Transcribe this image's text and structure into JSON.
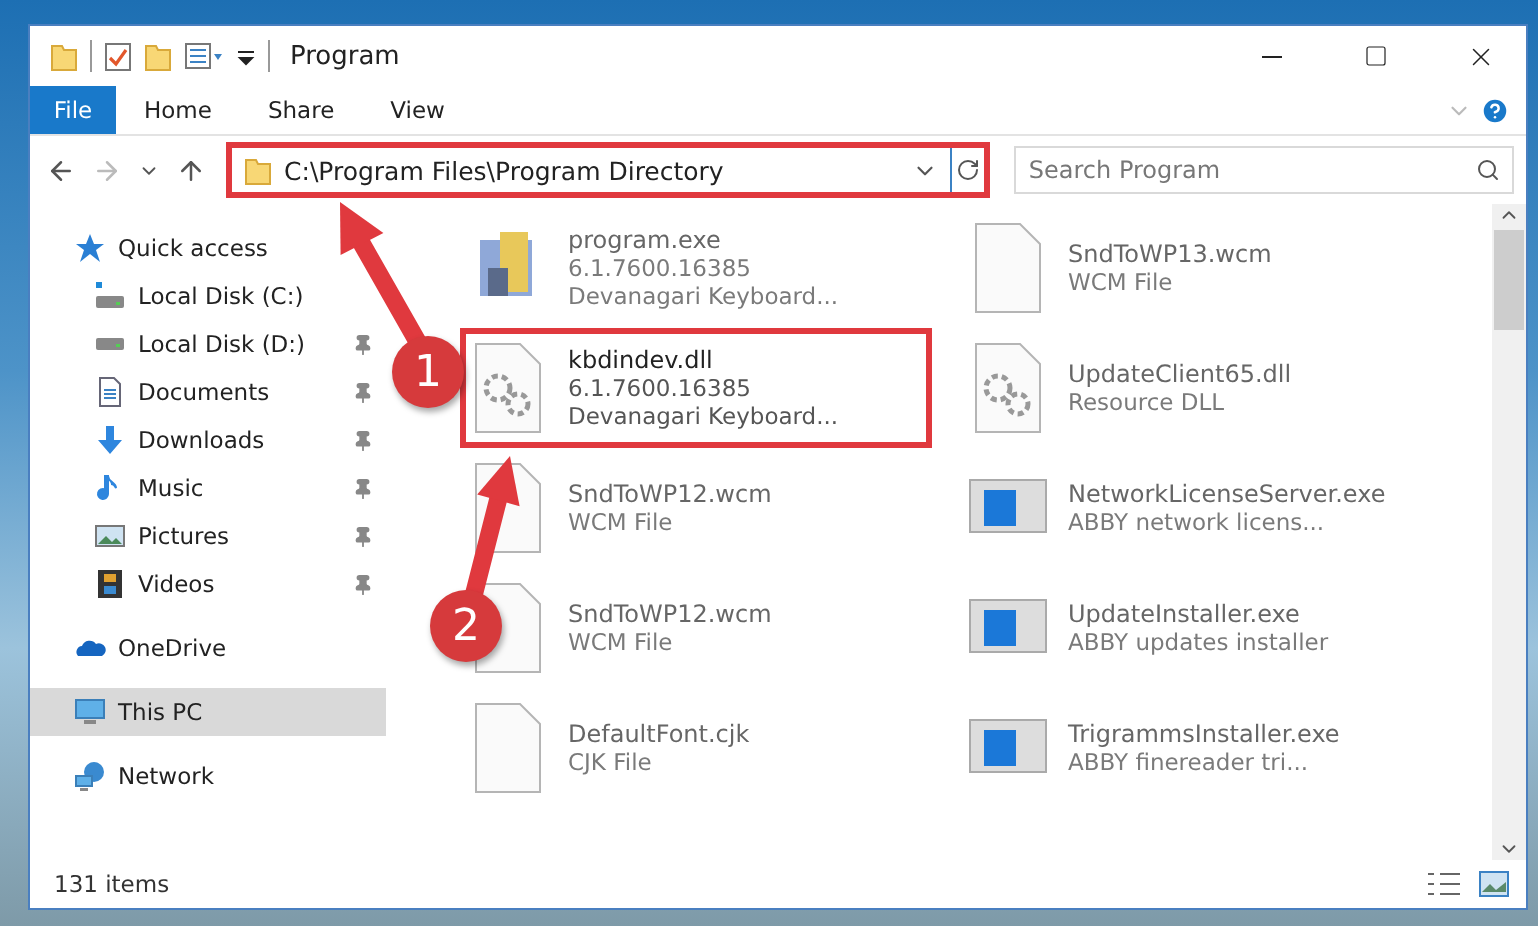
{
  "window": {
    "title": "Program"
  },
  "ribbon_tabs": [
    {
      "label": "File",
      "kind": "file",
      "selected": true
    },
    {
      "label": "Home",
      "kind": "tab",
      "selected": false
    },
    {
      "label": "Share",
      "kind": "tab",
      "selected": false
    },
    {
      "label": "View",
      "kind": "tab",
      "selected": false
    }
  ],
  "address": {
    "path": "C:\\Program Files\\Program Directory",
    "annotated": true
  },
  "search": {
    "placeholder": "Search Program"
  },
  "sidebar": {
    "items": [
      {
        "label": "Quick access",
        "kind": "star",
        "selected": false,
        "children": [
          {
            "label": "Local Disk (C:)",
            "kind": "system-drive",
            "pinned": false,
            "selected": false
          },
          {
            "label": "Local Disk (D:)",
            "kind": "drive",
            "pinned": true,
            "selected": false
          },
          {
            "label": "Documents",
            "kind": "documents",
            "pinned": true,
            "selected": false
          },
          {
            "label": "Downloads",
            "kind": "downloads",
            "pinned": true,
            "selected": false
          },
          {
            "label": "Music",
            "kind": "music",
            "pinned": true,
            "selected": false
          },
          {
            "label": "Pictures",
            "kind": "pictures",
            "pinned": true,
            "selected": false
          },
          {
            "label": "Videos",
            "kind": "videos",
            "pinned": true,
            "selected": false
          }
        ]
      },
      {
        "label": "OneDrive",
        "kind": "cloud",
        "selected": false
      },
      {
        "label": "This PC",
        "kind": "pc",
        "selected": true
      },
      {
        "label": "Network",
        "kind": "network",
        "selected": false
      }
    ]
  },
  "files": [
    {
      "name": "program.exe",
      "details": [
        "6.1.7600.16385",
        "Devanagari Keyboard..."
      ],
      "kind": "installer",
      "dimmed": true,
      "annotated": false
    },
    {
      "name": "SndToWP13.wcm",
      "details": [
        "WCM File"
      ],
      "kind": "blank",
      "dimmed": true,
      "annotated": false
    },
    {
      "name": "kbdindev.dll",
      "details": [
        "6.1.7600.16385",
        "Devanagari Keyboard..."
      ],
      "kind": "dll",
      "dimmed": false,
      "annotated": true
    },
    {
      "name": "UpdateClient65.dll",
      "details": [
        "Resource DLL"
      ],
      "kind": "dll",
      "dimmed": true,
      "annotated": false
    },
    {
      "name": "SndToWP12.wcm",
      "details": [
        "WCM File"
      ],
      "kind": "blank",
      "dimmed": true,
      "annotated": false
    },
    {
      "name": "NetworkLicenseServer.exe",
      "details": [
        "ABBY network licens..."
      ],
      "kind": "app",
      "dimmed": true,
      "annotated": false
    },
    {
      "name": "SndToWP12.wcm",
      "details": [
        "WCM File"
      ],
      "kind": "blank",
      "dimmed": true,
      "annotated": false
    },
    {
      "name": "UpdateInstaller.exe",
      "details": [
        "ABBY updates installer"
      ],
      "kind": "app",
      "dimmed": true,
      "annotated": false
    },
    {
      "name": "DefaultFont.cjk",
      "details": [
        "CJK File"
      ],
      "kind": "blank",
      "dimmed": true,
      "annotated": false
    },
    {
      "name": "TrigrammsInstaller.exe",
      "details": [
        "ABBY finereader tri..."
      ],
      "kind": "app",
      "dimmed": true,
      "annotated": false
    }
  ],
  "status_bar": {
    "item_count": "131 items"
  },
  "annotations": [
    {
      "label": "1"
    },
    {
      "label": "2"
    }
  ]
}
